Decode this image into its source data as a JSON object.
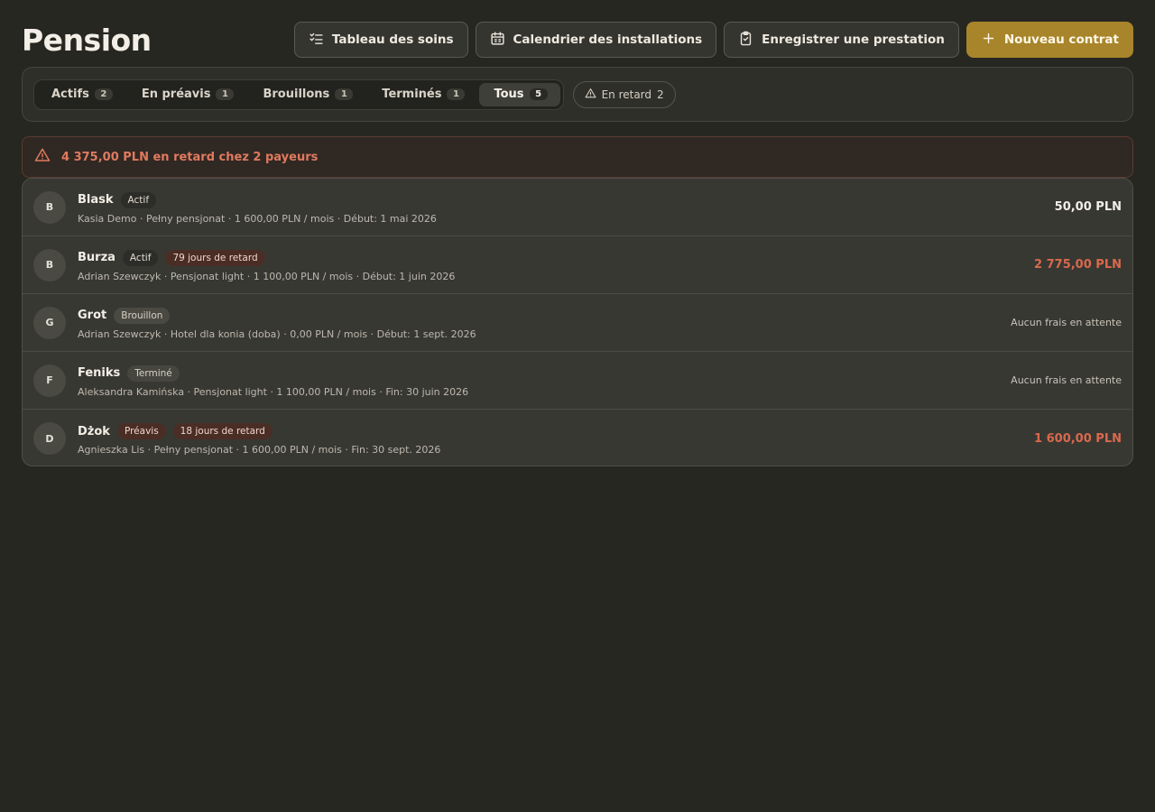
{
  "header": {
    "title": "Pension",
    "actions": [
      {
        "label": "Tableau des soins",
        "icon": "checklist-icon"
      },
      {
        "label": "Calendrier des installations",
        "icon": "calendar-icon"
      },
      {
        "label": "Enregistrer une prestation",
        "icon": "clipboard-check-icon"
      },
      {
        "label": "Nouveau contrat",
        "icon": "plus-icon"
      }
    ]
  },
  "filters": {
    "tabs": [
      {
        "label": "Actifs",
        "count": "2"
      },
      {
        "label": "En préavis",
        "count": "1"
      },
      {
        "label": "Brouillons",
        "count": "1"
      },
      {
        "label": "Terminés",
        "count": "1"
      },
      {
        "label": "Tous",
        "count": "5"
      }
    ],
    "active_tab": "Tous",
    "overdue": {
      "label": "En retard",
      "count": "2",
      "icon": "warning-icon"
    }
  },
  "alert": {
    "text": "4 375,00 PLN en retard chez 2 payeurs",
    "icon": "warning-icon"
  },
  "contracts": [
    {
      "initial": "B",
      "name": "Blask",
      "status": "Actif",
      "late": "",
      "meta": "Kasia Demo · Pełny pensjonat · 1 600,00 PLN / mois · Début: 1 mai 2026",
      "amount": "50,00 PLN"
    },
    {
      "initial": "B",
      "name": "Burza",
      "status": "Actif",
      "late": "79 jours de retard",
      "meta": "Adrian Szewczyk · Pensjonat light · 1 100,00 PLN / mois · Début: 1 juin 2026",
      "amount": "2 775,00 PLN"
    },
    {
      "initial": "G",
      "name": "Grot",
      "status": "Brouillon",
      "late": "",
      "meta": "Adrian Szewczyk · Hotel dla konia (doba) · 0,00 PLN / mois · Début: 1 sept. 2026",
      "amount": "Aucun frais en attente"
    },
    {
      "initial": "F",
      "name": "Feniks",
      "status": "Terminé",
      "late": "",
      "meta": "Aleksandra Kamińska · Pensjonat light · 1 100,00 PLN / mois · Fin: 30 juin 2026",
      "amount": "Aucun frais en attente"
    },
    {
      "initial": "D",
      "name": "Dżok",
      "status": "Préavis",
      "late": "18 jours de retard",
      "meta": "Agnieszka Lis · Pełny pensjonat · 1 600,00 PLN / mois · Fin: 30 sept. 2026",
      "amount": "1 600,00 PLN"
    }
  ],
  "colors": {
    "background": "#272722",
    "accent": "#a8852a",
    "overdue": "#d9694d"
  }
}
